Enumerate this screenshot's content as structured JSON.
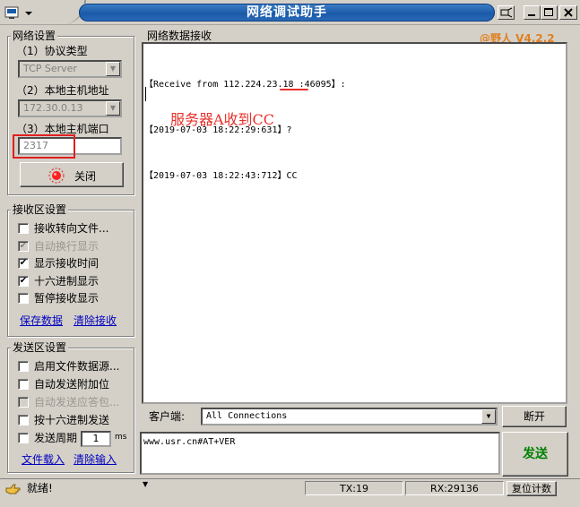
{
  "window": {
    "title": "网络调试助手",
    "sysmenu_icon": "app-icon",
    "controls": [
      "restore-icon",
      "minimize-icon",
      "maximize-icon",
      "close-icon"
    ]
  },
  "version": "@野人 V4.2.2",
  "net_settings": {
    "legend": "网络设置",
    "protocol_label": "（1）协议类型",
    "protocol_value": "TCP Server",
    "host_label": "（2）本地主机地址",
    "host_value": "172.30.0.13",
    "port_label": "（3）本地主机端口",
    "port_value": "2317",
    "close_button": "关闭"
  },
  "recv_settings": {
    "legend": "接收区设置",
    "options": [
      {
        "label": "接收转向文件...",
        "checked": false,
        "disabled": false
      },
      {
        "label": "自动换行显示",
        "checked": true,
        "disabled": true
      },
      {
        "label": "显示接收时间",
        "checked": true,
        "disabled": false
      },
      {
        "label": "十六进制显示",
        "checked": true,
        "disabled": false
      },
      {
        "label": "暂停接收显示",
        "checked": false,
        "disabled": false
      }
    ],
    "save_link": "保存数据",
    "clear_link": "清除接收"
  },
  "send_settings": {
    "legend": "发送区设置",
    "options": [
      {
        "label": "启用文件数据源...",
        "checked": false,
        "disabled": false
      },
      {
        "label": "自动发送附加位",
        "checked": false,
        "disabled": false
      },
      {
        "label": "自动发送应答包...",
        "checked": false,
        "disabled": true
      },
      {
        "label": "按十六进制发送",
        "checked": false,
        "disabled": false
      },
      {
        "label": "发送周期",
        "checked": false,
        "disabled": false
      }
    ],
    "period_value": "1",
    "period_unit": "ms",
    "load_link": "文件载入",
    "clear_link": "清除输入"
  },
  "recv_area": {
    "legend": "网络数据接收",
    "lines": [
      "【Receive from 112.224.23.18 :46095】:",
      "【2019-07-03 18:22:29:631】?",
      "【2019-07-03 18:22:43:712】CC"
    ],
    "annotation": "服务器A收到CC",
    "annotation_color": "#e8302a"
  },
  "client": {
    "label": "客户端:",
    "value": "All Connections",
    "disconnect_button": "断开"
  },
  "send_area": {
    "text": "www.usr.cn#AT+VER",
    "send_button": "发送",
    "send_color": "#008000"
  },
  "status": {
    "icon": "hand-icon",
    "text": "就绪!",
    "tx": "TX:19",
    "rx": "RX:29136",
    "reset_button": "复位计数"
  }
}
